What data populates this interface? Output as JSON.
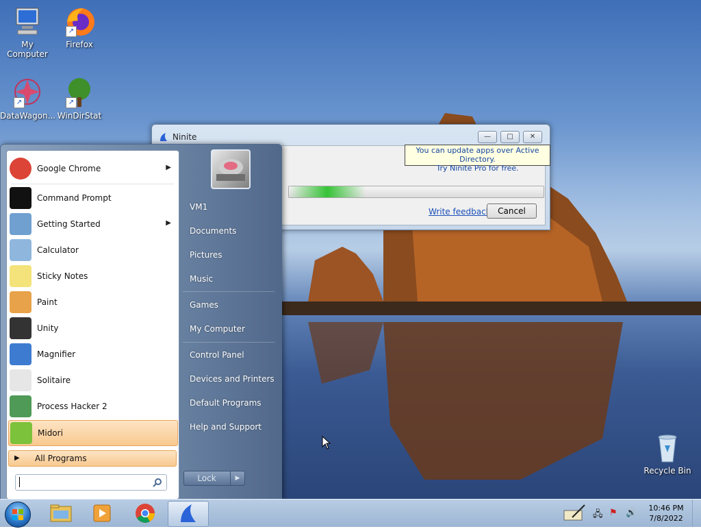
{
  "desktop": {
    "icons": [
      {
        "label": "My Computer",
        "icon": "computer-icon"
      },
      {
        "label": "Firefox",
        "icon": "firefox-icon"
      },
      {
        "label": "DataWagon...",
        "icon": "datawagon-icon"
      },
      {
        "label": "WinDirStat",
        "icon": "windirstat-icon"
      },
      {
        "label": "Recycle Bin",
        "icon": "recycle-bin-icon"
      }
    ]
  },
  "ninite": {
    "title": "Ninite",
    "notice_line1": "You can update apps over Active Directory.",
    "notice_line2": "Try Ninite Pro for free.",
    "progress": 0.3,
    "feedback_link": "Write feedback",
    "cancel_label": "Cancel"
  },
  "start_menu": {
    "programs": [
      {
        "label": "Google Chrome",
        "icon": "chrome-icon",
        "submenu": true
      },
      {
        "label": "Command Prompt",
        "icon": "command-prompt-icon",
        "submenu": false
      },
      {
        "label": "Getting Started",
        "icon": "getting-started-icon",
        "submenu": true
      },
      {
        "label": "Calculator",
        "icon": "calculator-icon",
        "submenu": false
      },
      {
        "label": "Sticky Notes",
        "icon": "sticky-notes-icon",
        "submenu": false
      },
      {
        "label": "Paint",
        "icon": "paint-icon",
        "submenu": false
      },
      {
        "label": "Unity",
        "icon": "unity-icon",
        "submenu": false
      },
      {
        "label": "Magnifier",
        "icon": "magnifier-icon",
        "submenu": false
      },
      {
        "label": "Solitaire",
        "icon": "solitaire-icon",
        "submenu": false
      },
      {
        "label": "Process Hacker 2",
        "icon": "process-hacker-icon",
        "submenu": false
      },
      {
        "label": "Midori",
        "icon": "midori-icon",
        "submenu": false,
        "highlighted": true
      }
    ],
    "all_programs": "All Programs",
    "search_placeholder": "",
    "right_items": [
      "VM1",
      "Documents",
      "Pictures",
      "Music",
      "Games",
      "My Computer",
      "Control Panel",
      "Devices and Printers",
      "Default Programs",
      "Help and Support"
    ],
    "lock_label": "Lock"
  },
  "taskbar": {
    "pinned": [
      "windows-explorer-icon",
      "media-player-icon",
      "chrome-icon",
      "ninite-icon"
    ],
    "time": "10:46 PM",
    "date": "7/8/2022"
  }
}
